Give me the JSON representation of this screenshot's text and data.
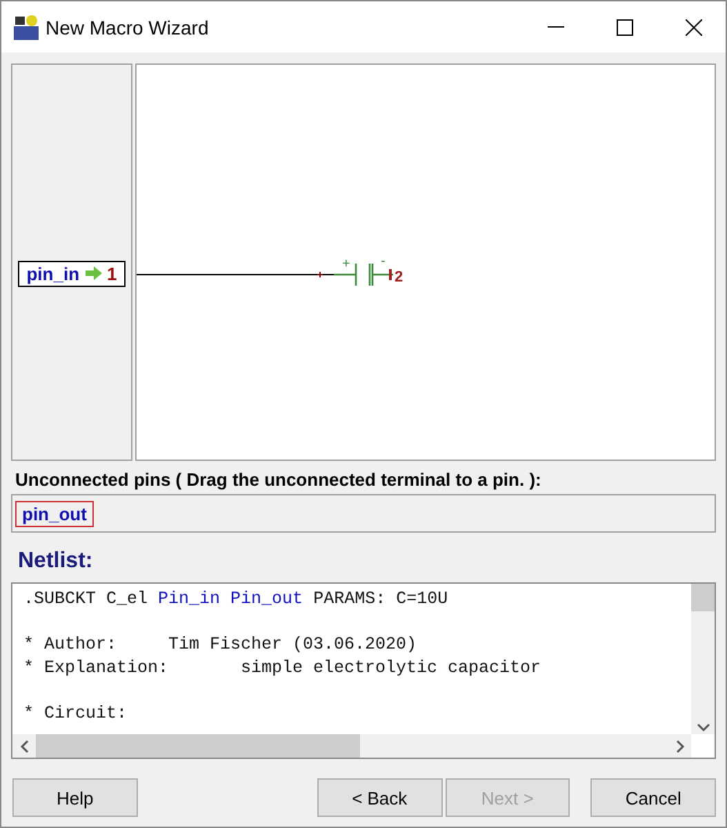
{
  "window": {
    "title": "New Macro Wizard"
  },
  "pins": [
    {
      "name": "pin_in",
      "number": "1"
    }
  ],
  "symbol": {
    "plus_label": "+",
    "minus_label": "-",
    "pin_number": "2"
  },
  "unconnected": {
    "label": "Unconnected pins ( Drag the unconnected terminal to a pin. ):",
    "pins": [
      {
        "name": "pin_out",
        "selected": true
      }
    ]
  },
  "netlist": {
    "label": "Netlist:",
    "lines": [
      {
        "blank_before": false,
        "segments": [
          {
            "text": ".SUBCKT C_el ",
            "kind": "plain"
          },
          {
            "text": "Pin_in Pin_out",
            "kind": "pin"
          },
          {
            "text": " PARAMS: C=10U",
            "kind": "plain"
          }
        ]
      },
      {
        "blank_before": true,
        "segments": [
          {
            "text": "* Author:     Tim Fischer (03.06.2020)",
            "kind": "plain"
          }
        ]
      },
      {
        "blank_before": false,
        "segments": [
          {
            "text": "* Explanation:       simple electrolytic capacitor",
            "kind": "plain"
          }
        ]
      },
      {
        "blank_before": true,
        "segments": [
          {
            "text": "* Circuit:",
            "kind": "plain"
          }
        ]
      }
    ]
  },
  "buttons": [
    {
      "label": "Help",
      "disabled": false
    },
    {
      "label": "< Back",
      "disabled": false
    },
    {
      "label": "Next >",
      "disabled": true
    },
    {
      "label": "Cancel",
      "disabled": false
    }
  ]
}
